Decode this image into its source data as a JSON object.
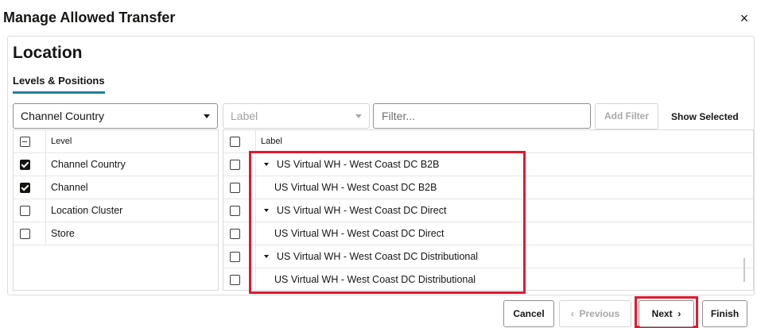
{
  "dialog": {
    "title": "Manage Allowed Transfer",
    "close_label": "×"
  },
  "section": {
    "title": "Location",
    "tab_label": "Levels & Positions"
  },
  "controls": {
    "level_select_value": "Channel Country",
    "label_select_placeholder": "Label",
    "filter_placeholder": "Filter...",
    "add_filter_label": "Add Filter",
    "show_selected_label": "Show Selected"
  },
  "levels_grid": {
    "header": "Level",
    "rows": [
      {
        "label": "Channel Country",
        "checked": true
      },
      {
        "label": "Channel",
        "checked": true
      },
      {
        "label": "Location Cluster",
        "checked": false
      },
      {
        "label": "Store",
        "checked": false
      }
    ]
  },
  "positions_grid": {
    "header": "Label",
    "rows": [
      {
        "label": "US Virtual WH - West Coast DC B2B",
        "expandable": true
      },
      {
        "label": "US Virtual WH - West Coast DC B2B",
        "expandable": false
      },
      {
        "label": "US Virtual WH - West Coast DC Direct",
        "expandable": true
      },
      {
        "label": "US Virtual WH - West Coast DC Direct",
        "expandable": false
      },
      {
        "label": "US Virtual WH - West Coast DC Distributional",
        "expandable": true
      },
      {
        "label": "US Virtual WH - West Coast DC Distributional",
        "expandable": false
      }
    ]
  },
  "footer": {
    "cancel_label": "Cancel",
    "previous_label": "Previous",
    "next_label": "Next",
    "finish_label": "Finish"
  },
  "colors": {
    "highlight": "#e3182d",
    "tab_underline": "#227e9e"
  }
}
